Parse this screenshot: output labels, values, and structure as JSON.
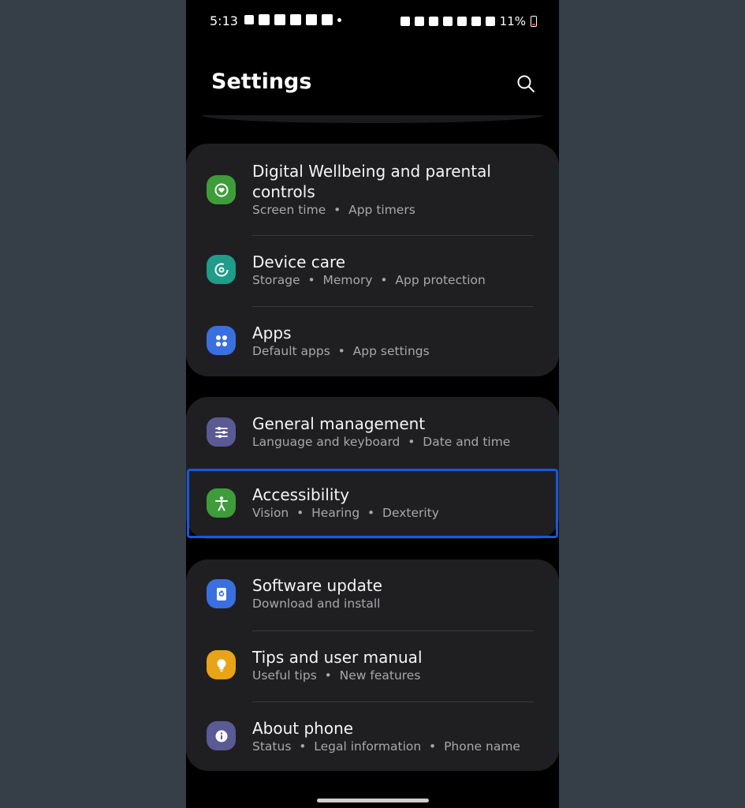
{
  "status_bar": {
    "time": "5:13",
    "battery": "11%"
  },
  "header": {
    "title": "Settings",
    "search_icon": "search-icon"
  },
  "groups": [
    {
      "items": [
        {
          "title": "Digital Wellbeing and parental controls",
          "subtitle": [
            "Screen time",
            "App timers"
          ],
          "icon": "digital-wellbeing-icon",
          "color": "#3e9d3a"
        },
        {
          "title": "Device care",
          "subtitle": [
            "Storage",
            "Memory",
            "App protection"
          ],
          "icon": "device-care-icon",
          "color": "#1f9c8a"
        },
        {
          "title": "Apps",
          "subtitle": [
            "Default apps",
            "App settings"
          ],
          "icon": "apps-icon",
          "color": "#3a6fe0"
        }
      ]
    },
    {
      "items": [
        {
          "title": "General management",
          "subtitle": [
            "Language and keyboard",
            "Date and time"
          ],
          "icon": "sliders-icon",
          "color": "#5b5a95"
        },
        {
          "title": "Accessibility",
          "subtitle": [
            "Vision",
            "Hearing",
            "Dexterity"
          ],
          "icon": "accessibility-icon",
          "color": "#3e9d3a",
          "highlighted": true
        }
      ]
    },
    {
      "items": [
        {
          "title": "Software update",
          "subtitle": [
            "Download and install"
          ],
          "icon": "software-update-icon",
          "color": "#3a6fe0"
        },
        {
          "title": "Tips and user manual",
          "subtitle": [
            "Useful tips",
            "New features"
          ],
          "icon": "lightbulb-icon",
          "color": "#e8a317"
        },
        {
          "title": "About phone",
          "subtitle": [
            "Status",
            "Legal information",
            "Phone name"
          ],
          "icon": "info-icon",
          "color": "#5b5a95"
        }
      ]
    }
  ],
  "highlight_color": "#1858e0"
}
